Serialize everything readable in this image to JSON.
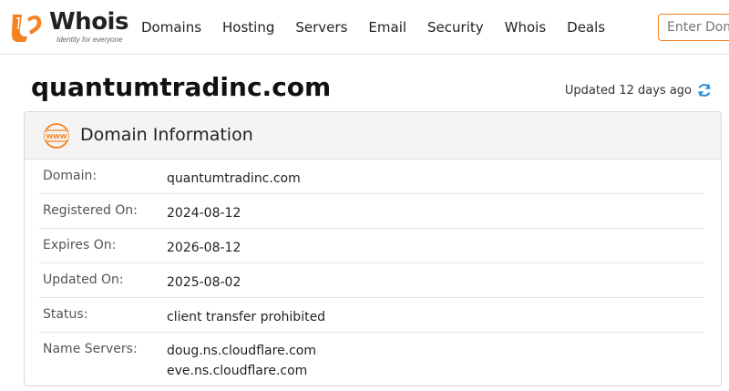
{
  "header": {
    "logo": {
      "brand_name": "Whois",
      "tagline": "Identity for everyone",
      "brand_color": "#f58220"
    },
    "nav": [
      {
        "label": "Domains"
      },
      {
        "label": "Hosting"
      },
      {
        "label": "Servers"
      },
      {
        "label": "Email"
      },
      {
        "label": "Security"
      },
      {
        "label": "Whois"
      },
      {
        "label": "Deals"
      }
    ],
    "search": {
      "placeholder": "Enter Domain",
      "value": ""
    }
  },
  "page": {
    "title": "quantumtradinc.com",
    "updated_text": "Updated 12 days ago",
    "refresh_icon": "refresh-icon"
  },
  "domain_info": {
    "title": "Domain Information",
    "icon": "www-icon",
    "rows": [
      {
        "label": "Domain:",
        "values": [
          "quantumtradinc.com"
        ]
      },
      {
        "label": "Registered On:",
        "values": [
          "2024-08-12"
        ]
      },
      {
        "label": "Expires On:",
        "values": [
          "2026-08-12"
        ]
      },
      {
        "label": "Updated On:",
        "values": [
          "2025-08-02"
        ]
      },
      {
        "label": "Status:",
        "values": [
          "client transfer prohibited"
        ]
      },
      {
        "label": "Name Servers:",
        "values": [
          "doug.ns.cloudflare.com",
          "eve.ns.cloudflare.com"
        ]
      }
    ]
  }
}
